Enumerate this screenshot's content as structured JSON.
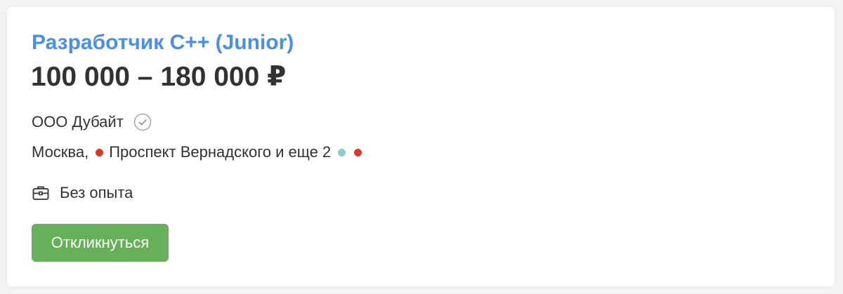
{
  "vacancy": {
    "title": "Разработчик C++ (Junior)",
    "salary": "100 000 – 180 000 ₽",
    "company": "ООО Дубайт",
    "city": "Москва,",
    "metro": "Проспект Вернадского",
    "more": " и еще 2",
    "experience": "Без опыта",
    "apply_label": "Откликнуться"
  },
  "colors": {
    "title": "#4a90e2",
    "button": "#66b057",
    "metro_red": "#d6382c",
    "metro_teal": "#8fcad3"
  },
  "icons": {
    "verified": "check-circle-icon",
    "experience": "briefcase-icon"
  }
}
